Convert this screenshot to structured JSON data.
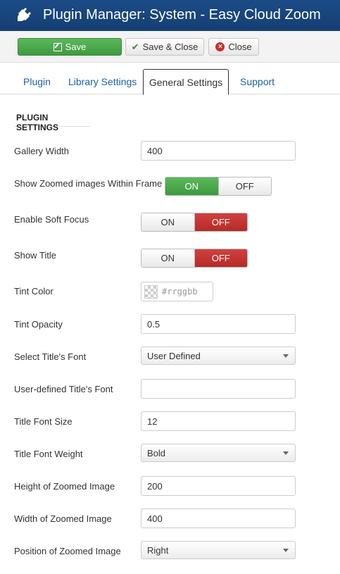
{
  "header": {
    "title": "Plugin Manager: System - Easy Cloud Zoom",
    "icon": "plug-icon"
  },
  "toolbar": {
    "save_label": "Save",
    "save_close_label": "Save & Close",
    "close_label": "Close"
  },
  "tabs": [
    {
      "label": "Plugin",
      "active": false
    },
    {
      "label": "Library Settings",
      "active": false
    },
    {
      "label": "General Settings",
      "active": true
    },
    {
      "label": "Support",
      "active": false
    }
  ],
  "section": {
    "title": "PLUGIN SETTINGS"
  },
  "fields": {
    "gallery_width": {
      "label": "Gallery Width",
      "value": "400"
    },
    "show_zoomed_within_frame": {
      "label": "Show Zoomed images Within Frame",
      "on": "ON",
      "off": "OFF",
      "selected": "ON"
    },
    "enable_soft_focus": {
      "label": "Enable Soft Focus",
      "on": "ON",
      "off": "OFF",
      "selected": "OFF"
    },
    "show_title": {
      "label": "Show Title",
      "on": "ON",
      "off": "OFF",
      "selected": "OFF"
    },
    "tint_color": {
      "label": "Tint Color",
      "placeholder": "#rrggbb"
    },
    "tint_opacity": {
      "label": "Tint Opacity",
      "value": "0.5"
    },
    "title_font": {
      "label": "Select Title's Font",
      "selected": "User Defined"
    },
    "user_title_font": {
      "label": "User-defined Title's Font",
      "value": ""
    },
    "title_font_size": {
      "label": "Title Font Size",
      "value": "12"
    },
    "title_font_weight": {
      "label": "Title Font Weight",
      "selected": "Bold"
    },
    "zoom_height": {
      "label": "Height of Zoomed Image",
      "value": "200"
    },
    "zoom_width": {
      "label": "Width of Zoomed Image",
      "value": "400"
    },
    "zoom_position": {
      "label": "Position of Zoomed Image",
      "selected": "Right"
    }
  },
  "colors": {
    "header_bg": "#1b4b86",
    "save_green": "#4cae4c",
    "on_green": "#4cae4c",
    "off_red": "#c9302c",
    "link_blue": "#1a62a8"
  }
}
